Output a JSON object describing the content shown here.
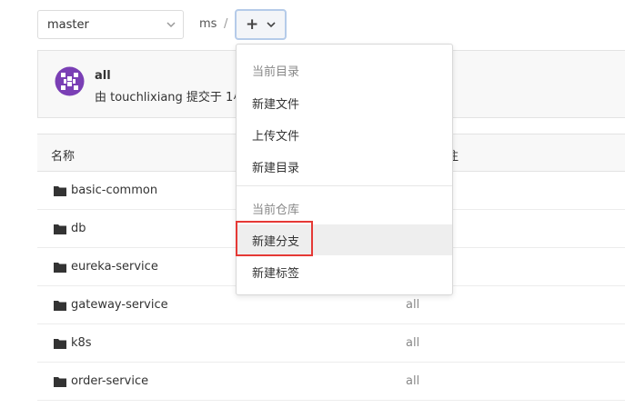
{
  "toolbar": {
    "branch": "master",
    "path_root": "ms",
    "path_sep": "/",
    "plus_label": "+"
  },
  "commit": {
    "title": "all",
    "meta": "由 touchlixiang 提交于 1小"
  },
  "table": {
    "headers": {
      "name": "名称",
      "message": "注"
    },
    "rows": [
      {
        "name": "basic-common",
        "message": ""
      },
      {
        "name": "db",
        "message": ""
      },
      {
        "name": "eureka-service",
        "message": ""
      },
      {
        "name": "gateway-service",
        "message": "all"
      },
      {
        "name": "k8s",
        "message": "all"
      },
      {
        "name": "order-service",
        "message": "all"
      }
    ]
  },
  "dropdown": {
    "section_current_dir": "当前目录",
    "new_file": "新建文件",
    "upload_file": "上传文件",
    "new_directory": "新建目录",
    "section_current_repo": "当前仓库",
    "new_branch": "新建分支",
    "new_tag": "新建标签"
  },
  "colors": {
    "highlight": "#e53935",
    "avatar_purple": "#7a3fb5",
    "plus_border": "#b5cbe9"
  },
  "icons": [
    "chevron-down-icon",
    "plus-icon",
    "folder-icon",
    "avatar-icon"
  ]
}
